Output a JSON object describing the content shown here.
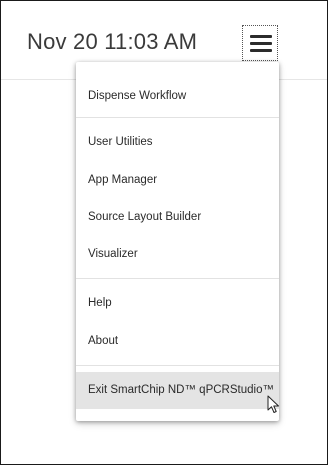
{
  "header": {
    "datetime": "Nov 20  11:03 AM",
    "menu_button": "menu-icon"
  },
  "menu": {
    "items": [
      {
        "label": "Dispense Workflow"
      },
      {
        "label": "User Utilities"
      },
      {
        "label": "App Manager"
      },
      {
        "label": "Source Layout Builder"
      },
      {
        "label": "Visualizer"
      },
      {
        "label": "Help"
      },
      {
        "label": "About"
      },
      {
        "label": "Exit SmartChip ND™ qPCRStudio™"
      }
    ],
    "hovered_item": "Exit SmartChip ND™ qPCRStudio™"
  },
  "colors": {
    "hover_background": "#e4e4e4",
    "text": "#2a2a2a"
  }
}
